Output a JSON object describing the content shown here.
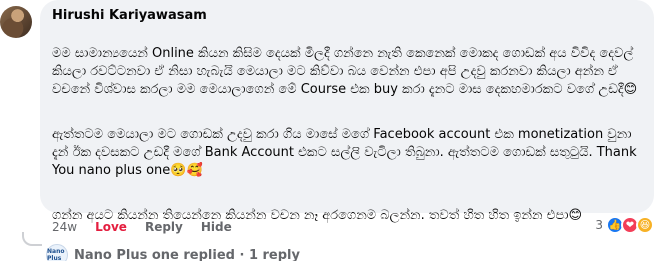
{
  "comment": {
    "author": "Hirushi Kariyawasam",
    "paragraphs": [
      "මම සාමාන්‍යයෙන් Online කියන කිසිම දෙයක් මිලදී ගන්නෙ නැති කෙනෙක් මොකද ගොඩක් අය විවිද දෙවල් කියලා රවට්ටනවා ඒ නිසා හැබැයි මෙයාලා මට කිව්වා බය වෙන්න එපා අපි උදවු කරනවා කියලා අන්න ඒ වචනේ විශ්වාස කරලා මම මෙයාලාගෙන් මේ Course එක buy කරා දැනට මාස දෙකහමාරකට වගේ උඩදී",
      "ඇත්තටම මෙයාලා මට ගොඩක් උදවු කරා ගිය මාසේ මගේ Facebook account එක monetization වුනා දැන් ඊක දවසකට උඩදී මගේ Bank Account එකට සල්ලි වැටිලා තිබුනා. ඇත්තටම ගොඩක් සතුටුයි. Thank You nano plus one",
      "ගන්න අයට කියන්න තියෙන්නෙ කියන්න වචන නෑ අරගෙනම බලන්න. තවත් හිත හිත ඉන්න එපා"
    ],
    "emojis": [
      "😊",
      "🥺🥰",
      "😊"
    ]
  },
  "actions": {
    "time": "24w",
    "love": "Love",
    "reply": "Reply",
    "hide": "Hide"
  },
  "reactions": {
    "count": "3",
    "icons": [
      "like-icon",
      "love-icon",
      "haha-icon"
    ]
  },
  "replies": {
    "label": "Nano Plus one replied · 1 reply",
    "avatar_text": "Nano Plus"
  },
  "colors": {
    "bubble": "#f0f2f5",
    "love": "#e41e3f",
    "muted": "#65676b",
    "like": "#1877f2"
  }
}
